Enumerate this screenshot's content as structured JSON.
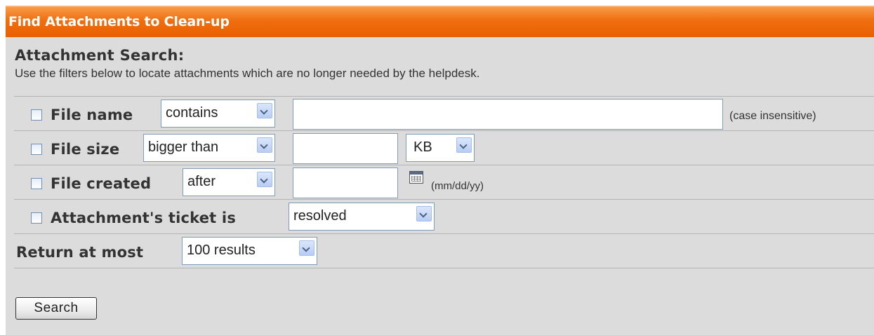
{
  "header": {
    "title": "Find Attachments to Clean-up"
  },
  "search": {
    "title": "Attachment Search:",
    "description": "Use the filters below to locate attachments which are no longer needed by the helpdesk."
  },
  "filters": {
    "file_name": {
      "label": "File name",
      "operator": "contains",
      "value": "",
      "hint": "(case insensitive)"
    },
    "file_size": {
      "label": "File size",
      "operator": "bigger than",
      "value": "",
      "unit": "KB"
    },
    "file_created": {
      "label": "File created",
      "operator": "after",
      "value": "",
      "hint": "(mm/dd/yy)"
    },
    "ticket_status": {
      "label": "Attachment's ticket is",
      "value": "resolved"
    }
  },
  "return_at_most": {
    "label": "Return at most",
    "value": "100 results"
  },
  "search_button": {
    "label": "Search"
  },
  "icons": {
    "checkbox": "checkbox-icon",
    "dropdown": "chevron-down-icon",
    "calendar": "calendar-icon"
  },
  "colors": {
    "header_orange": "#f06e0f",
    "panel_gray": "#dcdcdc"
  }
}
